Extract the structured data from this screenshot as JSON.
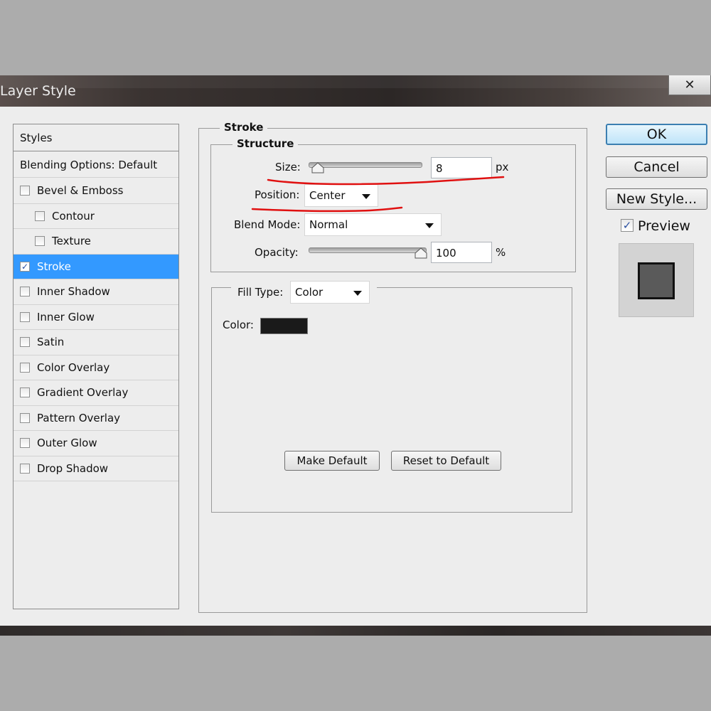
{
  "window": {
    "title": "Layer Style",
    "close_glyph": "✕"
  },
  "styles_list": {
    "header": "Styles",
    "blending": "Blending Options: Default",
    "items": [
      {
        "label": "Bevel & Emboss",
        "checked": false,
        "indent": false
      },
      {
        "label": "Contour",
        "checked": false,
        "indent": true
      },
      {
        "label": "Texture",
        "checked": false,
        "indent": true
      },
      {
        "label": "Stroke",
        "checked": true,
        "indent": false,
        "selected": true
      },
      {
        "label": "Inner Shadow",
        "checked": false,
        "indent": false
      },
      {
        "label": "Inner Glow",
        "checked": false,
        "indent": false
      },
      {
        "label": "Satin",
        "checked": false,
        "indent": false
      },
      {
        "label": "Color Overlay",
        "checked": false,
        "indent": false
      },
      {
        "label": "Gradient Overlay",
        "checked": false,
        "indent": false
      },
      {
        "label": "Pattern Overlay",
        "checked": false,
        "indent": false
      },
      {
        "label": "Outer Glow",
        "checked": false,
        "indent": false
      },
      {
        "label": "Drop Shadow",
        "checked": false,
        "indent": false
      }
    ],
    "selected_color": "#3399ff"
  },
  "stroke": {
    "group_title": "Stroke",
    "structure_title": "Structure",
    "size_label": "Size:",
    "size_value": "8",
    "size_unit": "px",
    "position_label": "Position:",
    "position_value": "Center",
    "blend_label": "Blend Mode:",
    "blend_value": "Normal",
    "opacity_label": "Opacity:",
    "opacity_value": "100",
    "opacity_unit": "%",
    "fill_type_label": "Fill Type:",
    "fill_type_value": "Color",
    "color_label": "Color:",
    "color_value": "#1a1a1a",
    "make_default": "Make Default",
    "reset_default": "Reset to Default"
  },
  "actions": {
    "ok": "OK",
    "cancel": "Cancel",
    "new_style": "New Style...",
    "preview_label": "Preview",
    "preview_checked": true
  },
  "annotation_color": "#e01010"
}
